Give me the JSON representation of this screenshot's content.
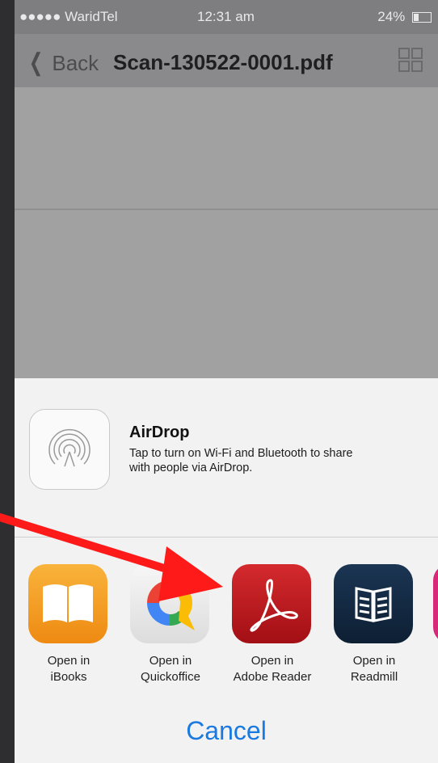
{
  "status_bar": {
    "carrier": "●●●●● WaridTel",
    "time": "12:31 am",
    "battery": "24%"
  },
  "nav": {
    "back_label": "Back",
    "title": "Scan-130522-0001.pdf"
  },
  "airdrop": {
    "title": "AirDrop",
    "line1": "Tap to turn on Wi-Fi and Bluetooth to share",
    "line2": "with people via AirDrop."
  },
  "apps": [
    {
      "line1": "Open in",
      "line2": "iBooks",
      "icon": "ibooks-icon",
      "color": "#f39a1c"
    },
    {
      "line1": "Open in",
      "line2": "Quickoffice",
      "icon": "quickoffice-icon",
      "color": "#e4e4e4"
    },
    {
      "line1": "Open in",
      "line2": "Adobe Reader",
      "icon": "adobe-reader-icon",
      "color": "#b5161c"
    },
    {
      "line1": "Open in",
      "line2": "Readmill",
      "icon": "readmill-icon",
      "color": "#12283f"
    }
  ],
  "cancel_label": "Cancel",
  "annotation": {
    "arrow_color": "#ff1a1a"
  }
}
